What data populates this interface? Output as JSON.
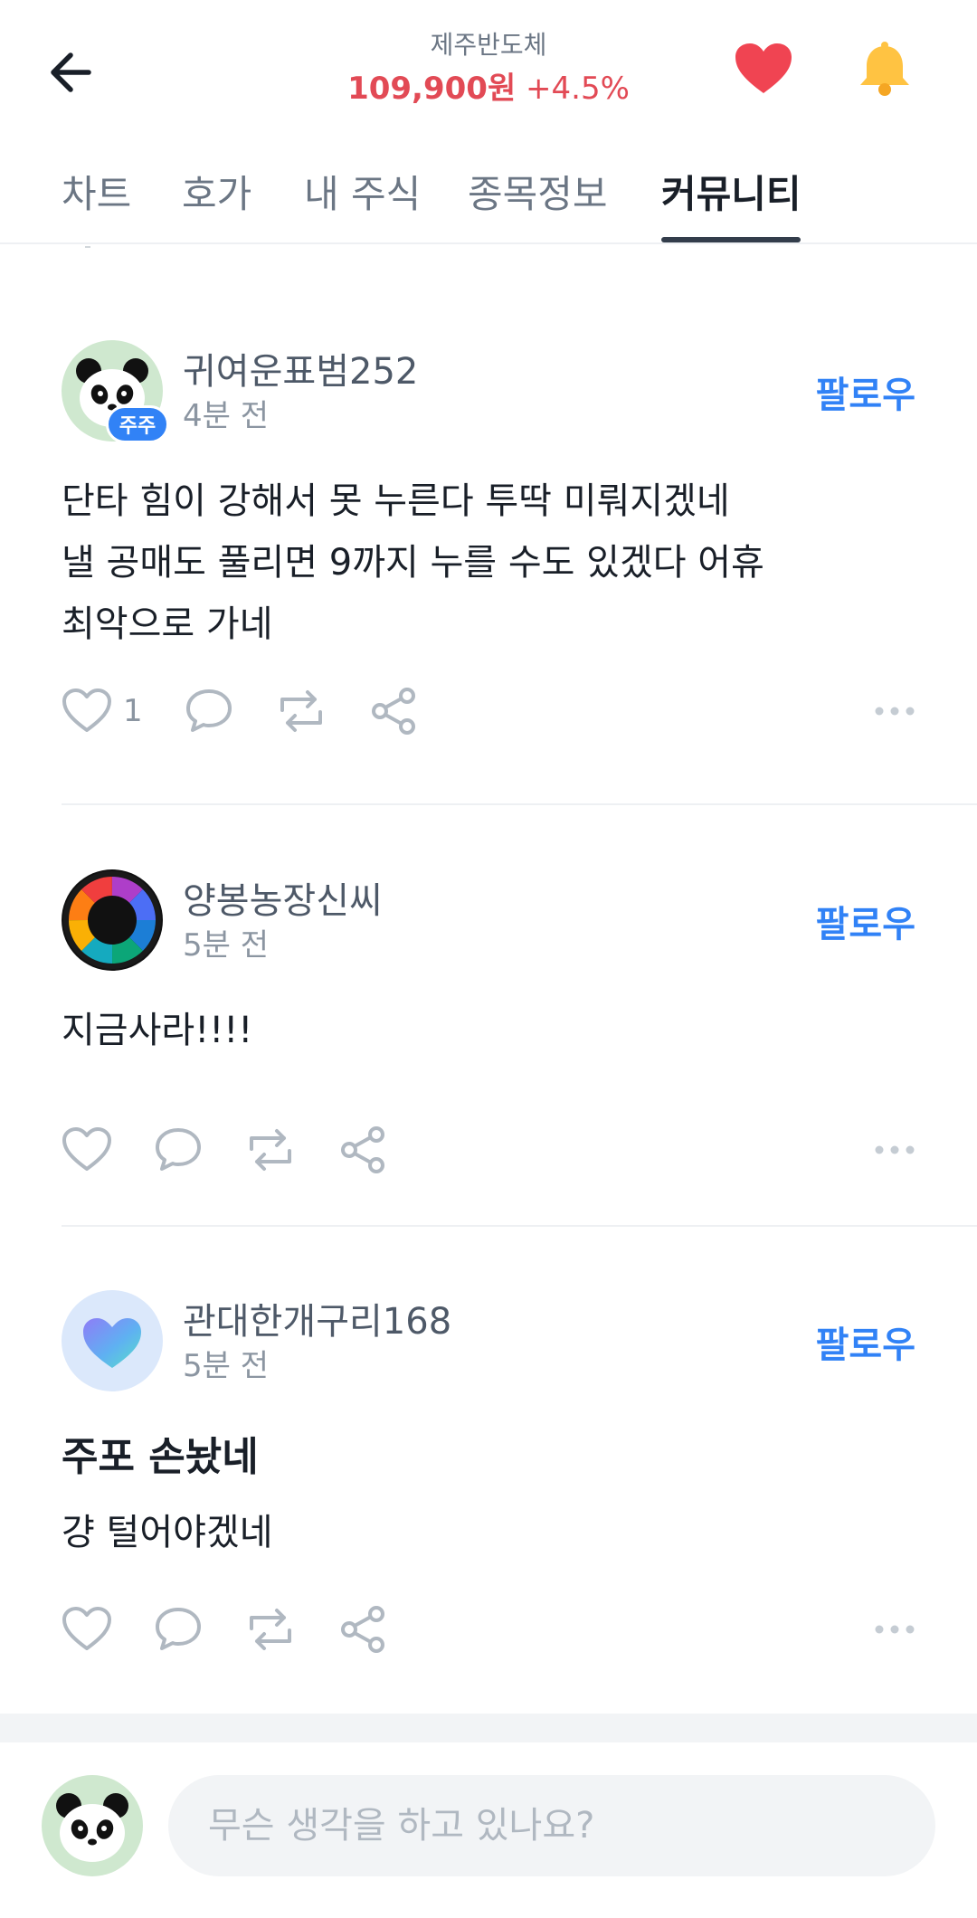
{
  "header": {
    "stock_name": "제주반도체",
    "price": "109,900원",
    "change": "+4.5%",
    "back_icon": "arrow-left-icon",
    "favorite_icon": "heart-icon",
    "bell_icon": "bell-icon",
    "colors": {
      "price": "#e24a55",
      "heart": "#f04452",
      "bell": "#ffc342"
    }
  },
  "tabs": [
    {
      "label": "차트",
      "active": false
    },
    {
      "label": "호가",
      "active": false
    },
    {
      "label": "내 주식",
      "active": false
    },
    {
      "label": "종목정보",
      "active": false
    },
    {
      "label": "커뮤니티",
      "active": true
    }
  ],
  "posts": [
    {
      "username": "귀여운표범252",
      "time": "4분 전",
      "badge": "주주",
      "avatar": "panda-avatar",
      "follow_label": "팔로우",
      "content": "단타 힘이 강해서 못 누른다 투딱 미뤄지겠네\n낼 공매도 풀리면 9까지 누를 수도 있겠다 어휴\n최악으로 가네",
      "like_count": "1"
    },
    {
      "username": "양봉농장신씨",
      "time": "5분 전",
      "avatar": "color-wheel-avatar",
      "follow_label": "팔로우",
      "content": "지금사라!!!!"
    },
    {
      "username": "관대한개구리168",
      "time": "5분 전",
      "avatar": "blue-heart-avatar",
      "follow_label": "팔로우",
      "title": "주포 손놨네",
      "content": "걍 털어야겠네"
    }
  ],
  "composer": {
    "placeholder": "무슨 생각을 하고 있나요?",
    "avatar": "panda-avatar"
  },
  "accent_color": "#3182f6"
}
